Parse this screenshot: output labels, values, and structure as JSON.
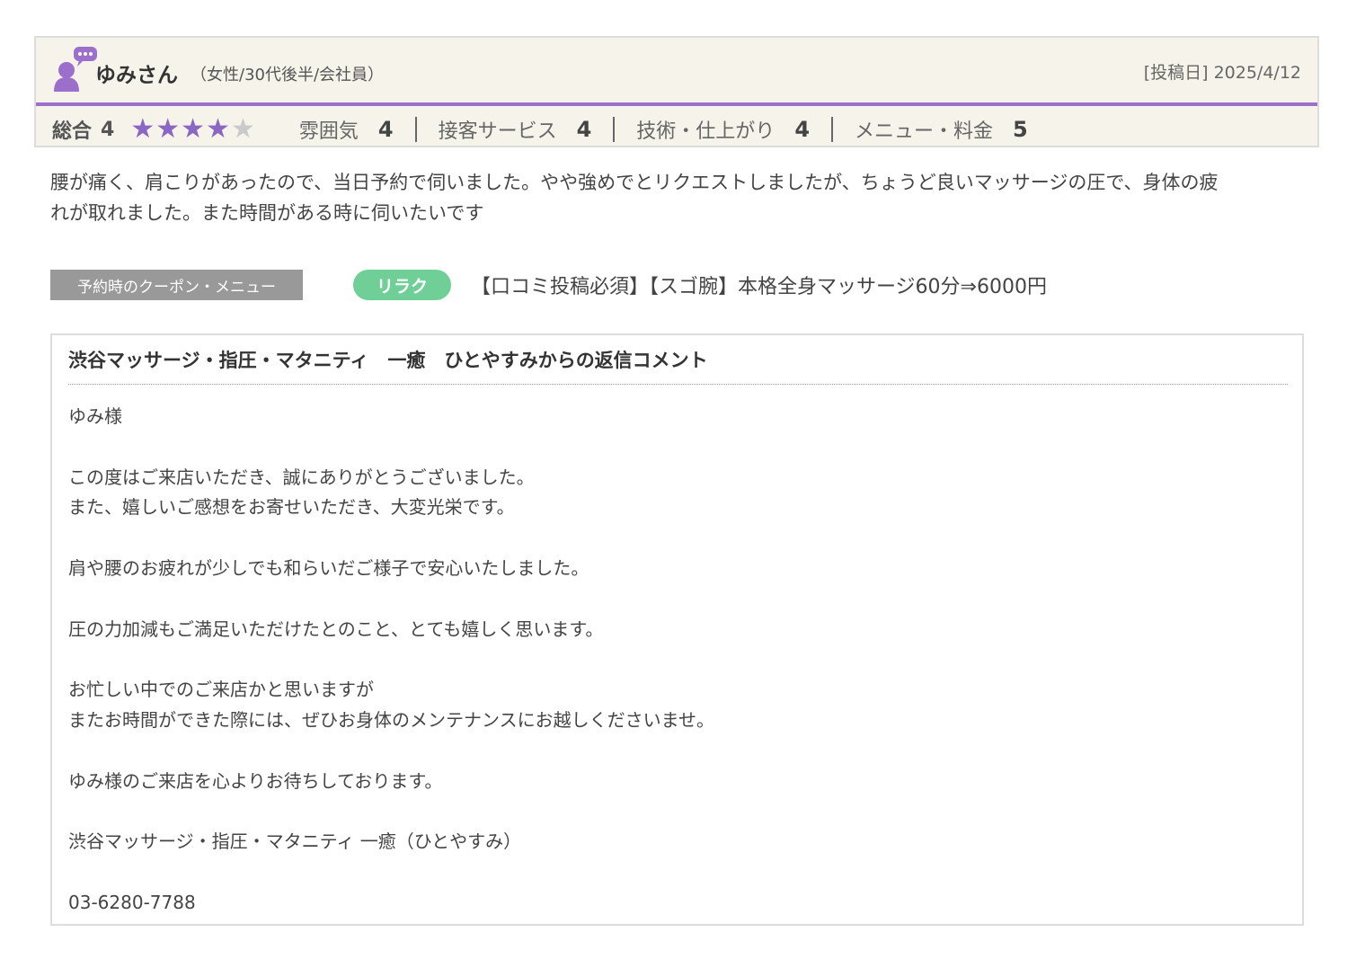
{
  "review": {
    "reviewer_name": "ゆみさん",
    "reviewer_attributes": "（女性/30代後半/会社員）",
    "post_date": "[投稿日] 2025/4/12",
    "overall_label": "総合",
    "overall_value": "4",
    "overall_stars": 4,
    "ratings": [
      {
        "label": "雰囲気",
        "value": "4"
      },
      {
        "label": "接客サービス",
        "value": "4"
      },
      {
        "label": "技術・仕上がり",
        "value": "4"
      },
      {
        "label": "メニュー・料金",
        "value": "5"
      }
    ],
    "body_lines": [
      "腰が痛く、肩こりがあったので、当日予約で伺いました。やや強めでとリクエストしましたが、ちょうど良いマッサージの圧で、身体の疲",
      "れが取れました。また時間がある時に伺いたいです"
    ],
    "colors": {
      "accent": "#9b6fcb",
      "star_on": "#8b67c4",
      "star_off": "#c9c9c9",
      "badge": "#6fcf97"
    }
  },
  "coupon": {
    "label": "予約時のクーポン・メニュー",
    "badge": "リラク",
    "title": "【口コミ投稿必須】【スゴ腕】本格全身マッサージ60分⇒6000円"
  },
  "reply": {
    "title": "渋谷マッサージ・指圧・マタニティ　一癒　ひとやすみからの返信コメント",
    "lines": [
      "ゆみ様",
      "",
      "この度はご来店いただき、誠にありがとうございました。",
      "また、嬉しいご感想をお寄せいただき、大変光栄です。",
      "",
      "肩や腰のお疲れが少しでも和らいだご様子で安心いたしました。",
      "",
      "圧の力加減もご満足いただけたとのこと、とても嬉しく思います。",
      "",
      "お忙しい中でのご来店かと思いますが",
      "またお時間ができた際には、ぜひお身体のメンテナンスにお越しくださいませ。",
      "",
      "ゆみ様のご来店を心よりお待ちしております。",
      "",
      "渋谷マッサージ・指圧・マタニティ 一癒（ひとやすみ）",
      "",
      "03-6280-7788"
    ]
  }
}
